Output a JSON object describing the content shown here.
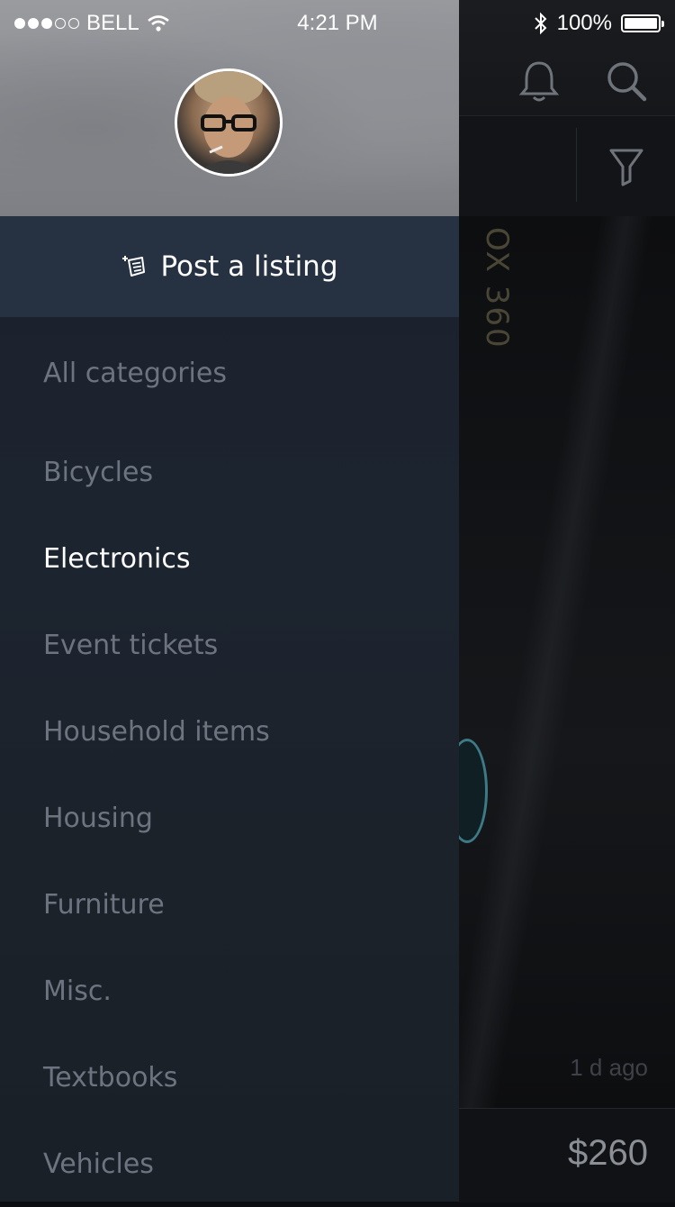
{
  "status_bar": {
    "carrier": "BELL",
    "time": "4:21 PM",
    "battery": "100%",
    "signal_bars_filled": 3,
    "signal_bars_total": 5
  },
  "drawer": {
    "post_button_label": "Post a listing",
    "categories": [
      {
        "label": "All categories",
        "active": false
      },
      {
        "label": "Bicycles",
        "active": false
      },
      {
        "label": "Electronics",
        "active": true
      },
      {
        "label": "Event tickets",
        "active": false
      },
      {
        "label": "Household items",
        "active": false
      },
      {
        "label": "Housing",
        "active": false
      },
      {
        "label": "Furniture",
        "active": false
      },
      {
        "label": "Misc.",
        "active": false
      },
      {
        "label": "Textbooks",
        "active": false
      },
      {
        "label": "Vehicles",
        "active": false
      }
    ]
  },
  "background_listing": {
    "product_text": "OX 360",
    "posted_ago": "1 d ago",
    "price": "$260"
  },
  "icons": {
    "notifications": "bell-icon",
    "search": "search-icon",
    "filter": "filter-icon",
    "post": "post-listing-icon"
  },
  "colors": {
    "drawer_bg": "#1c2430",
    "post_bar_bg": "#263242",
    "category_inactive": "#6d7480",
    "category_active": "#ffffff"
  }
}
